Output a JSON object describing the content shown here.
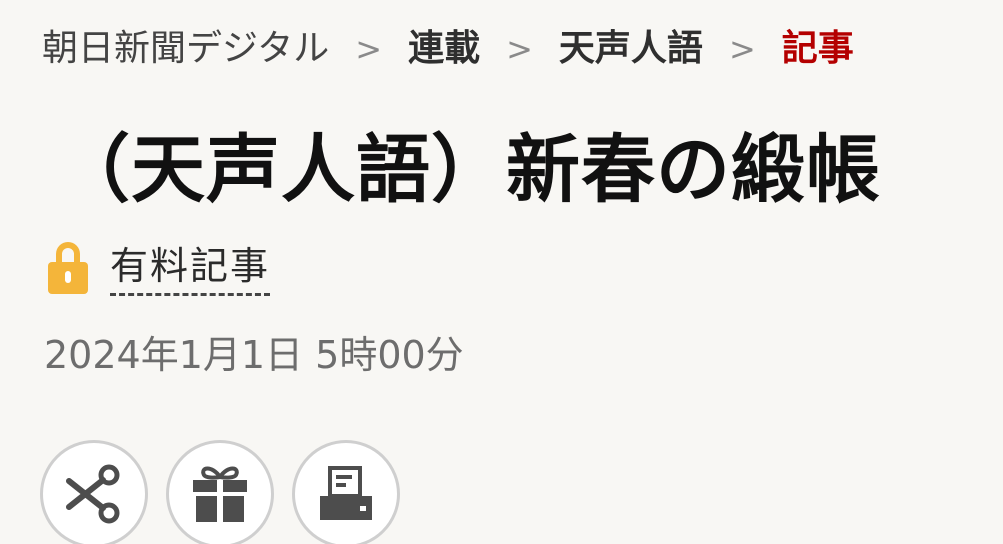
{
  "breadcrumb": {
    "items": [
      {
        "label": "朝日新聞デジタル"
      },
      {
        "label": "連載"
      },
      {
        "label": "天声人語"
      },
      {
        "label": "記事"
      }
    ],
    "separator": ">"
  },
  "article": {
    "title": "（天声人語）新春の緞帳",
    "paid_label": "有料記事",
    "date": "2024年1月1日 5時00分"
  },
  "actions": [
    {
      "icon": "scissors-icon"
    },
    {
      "icon": "gift-icon"
    },
    {
      "icon": "printer-icon"
    }
  ],
  "colors": {
    "background": "#f8f7f4",
    "current_crumb": "#b40000",
    "lock": "#f4b53a",
    "date": "#6d6d6d"
  }
}
